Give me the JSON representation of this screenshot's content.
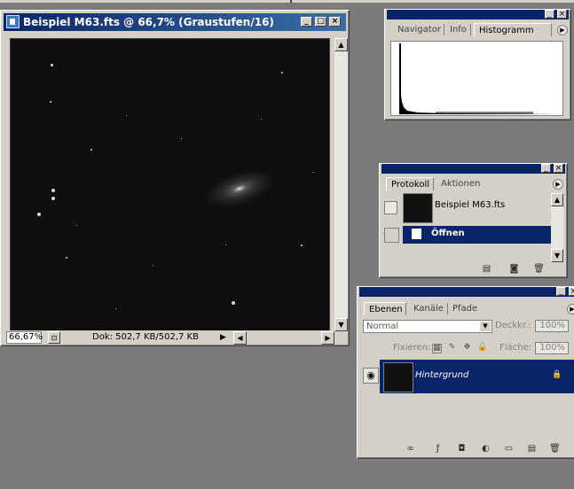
{
  "document": {
    "title": "Beispiel M63.fts @ 66,7% (Graustufen/16)",
    "zoom": "66,67%",
    "doc_info": "Dok: 502,7 KB/502,7 KB"
  },
  "histogram_panel": {
    "tabs": [
      "Navigator",
      "Info",
      "Histogramm"
    ],
    "active_tab": "Histogramm"
  },
  "history_panel": {
    "tabs": [
      "Protokoll",
      "Aktionen"
    ],
    "active_tab": "Protokoll",
    "snapshot_label": "Beispiel M63.fts",
    "steps": [
      "Öffnen"
    ]
  },
  "layers_panel": {
    "tabs": [
      "Ebenen",
      "Kanäle",
      "Pfade"
    ],
    "active_tab": "Ebenen",
    "blend_mode": "Normal",
    "opacity_label": "Deckkr.:",
    "opacity_value": "100%",
    "lock_label": "Fixieren:",
    "fill_label": "Fläche:",
    "fill_value": "100%",
    "layers": [
      {
        "name": "Hintergrund",
        "visible": true,
        "locked": true
      }
    ]
  },
  "colors": {
    "titlebar": "#0a246a",
    "selection": "#0a246a",
    "chrome": "#d4d0c8",
    "desktop": "#7b7b7b"
  },
  "icons": {
    "minimize": "minimize-icon",
    "maximize": "maximize-icon",
    "close": "close-icon",
    "palette_menu": "palette-menu-icon",
    "eye": "eye-icon",
    "lock": "lock-icon",
    "trash": "trash-icon",
    "new": "new-document-icon",
    "snapshot": "snapshot-icon"
  }
}
